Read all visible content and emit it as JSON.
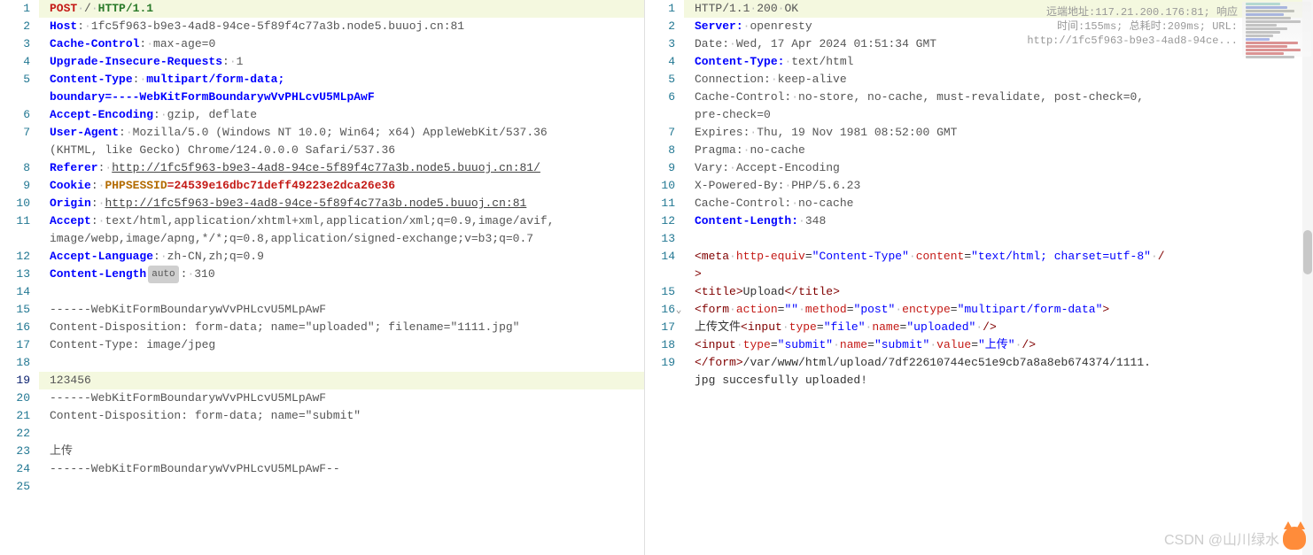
{
  "request": {
    "lines": 25,
    "active_line": 19,
    "method": "POST",
    "path": "/",
    "protocol": "HTTP/1.1",
    "host_k": "Host",
    "host_v": "1fc5f963-b9e3-4ad8-94ce-5f89f4c77a3b.node5.buuoj.cn:81",
    "cache_k": "Cache-Control",
    "cache_v": "max-age=0",
    "upgrade_k": "Upgrade-Insecure-Requests",
    "upgrade_v": "1",
    "ct_k": "Content-Type",
    "ct_v": "multipart/form-data;",
    "boundary": "boundary=----WebKitFormBoundarywVvPHLcvU5MLpAwF",
    "ae_k": "Accept-Encoding",
    "ae_v": "gzip, deflate",
    "ua_k": "User-Agent",
    "ua_v1": "Mozilla/5.0 (Windows NT 10.0; Win64; x64) AppleWebKit/537.36",
    "ua_v2": "(KHTML, like Gecko) Chrome/124.0.0.0 Safari/537.36",
    "ref_k": "Referer",
    "ref_v": "http://1fc5f963-b9e3-4ad8-94ce-5f89f4c77a3b.node5.buuoj.cn:81/",
    "cookie_k": "Cookie",
    "cookie_name": "PHPSESSID",
    "cookie_val": "24539e16dbc71deff49223e2dca26e36",
    "origin_k": "Origin",
    "origin_v": "http://1fc5f963-b9e3-4ad8-94ce-5f89f4c77a3b.node5.buuoj.cn:81",
    "acc_k": "Accept",
    "acc_v1": "text/html,application/xhtml+xml,application/xml;q=0.9,image/avif,",
    "acc_v2": "image/webp,image/apng,*/*;q=0.8,application/signed-exchange;v=b3;q=0.7",
    "al_k": "Accept-Language",
    "al_v": "zh-CN,zh;q=0.9",
    "cl_k": "Content-Length",
    "cl_badge": "auto",
    "cl_v": "310",
    "b1": "------WebKitFormBoundarywVvPHLcvU5MLpAwF",
    "cd1": "Content-Disposition: form-data; name=\"uploaded\"; filename=\"1111.jpg\"",
    "ct_body": "Content-Type: image/jpeg",
    "payload": "123456",
    "cd2": "Content-Disposition: form-data; name=\"submit\"",
    "submit_text": "上传",
    "b_end": "------WebKitFormBoundarywVvPHLcvU5MLpAwF--"
  },
  "response": {
    "lines": 19,
    "protocol": "HTTP/1.1",
    "status": "200",
    "reason": "OK",
    "server_k": "Server",
    "server_v": "openresty",
    "date_k": "Date",
    "date_v": "Wed, 17 Apr 2024 01:51:34 GMT",
    "ct_k": "Content-Type",
    "ct_v": "text/html",
    "conn_k": "Connection",
    "conn_v": "keep-alive",
    "cc_k": "Cache-Control",
    "cc_v1": "no-store, no-cache, must-revalidate, post-check=0,",
    "cc_v2": "pre-check=0",
    "exp_k": "Expires",
    "exp_v": "Thu, 19 Nov 1981 08:52:00 GMT",
    "prag_k": "Pragma",
    "prag_v": "no-cache",
    "vary_k": "Vary",
    "vary_v": "Accept-Encoding",
    "xpb_k": "X-Powered-By",
    "xpb_v": "PHP/5.6.23",
    "cc2_k": "Cache-Control",
    "cc2_v": "no-cache",
    "cl_k": "Content-Length",
    "cl_v": "348",
    "meta_tag": "meta",
    "meta_a1n": "http-equiv",
    "meta_a1v": "\"Content-Type\"",
    "meta_a2n": "content",
    "meta_a2v": "\"text/html; charset=utf-8\"",
    "title_tag": "title",
    "title_txt": "Upload",
    "form_tag": "form",
    "form_action_n": "action",
    "form_action_v": "\"\"",
    "form_method_n": "method",
    "form_method_v": "\"post\"",
    "form_enc_n": "enctype",
    "form_enc_v": "\"multipart/form-data\"",
    "upload_label": "上传文件",
    "input_tag": "input",
    "i1_type": "\"file\"",
    "i1_name": "\"uploaded\"",
    "i2_type": "\"submit\"",
    "i2_name": "\"submit\"",
    "i2_value": "\"上传\"",
    "result1": "/var/www/html/upload/7df22610744ec51e9cb7a8a8eb674374/1111.",
    "result2": "jpg succesfully uploaded!",
    "attr_type": "type",
    "attr_name": "name",
    "attr_value": "value"
  },
  "info": {
    "l1": "远端地址:117.21.200.176:81; 响应",
    "l2": "时间:155ms; 总耗时:209ms; URL:",
    "l3": "http://1fc5f963-b9e3-4ad8-94ce..."
  },
  "watermark": "CSDN @山川绿水"
}
